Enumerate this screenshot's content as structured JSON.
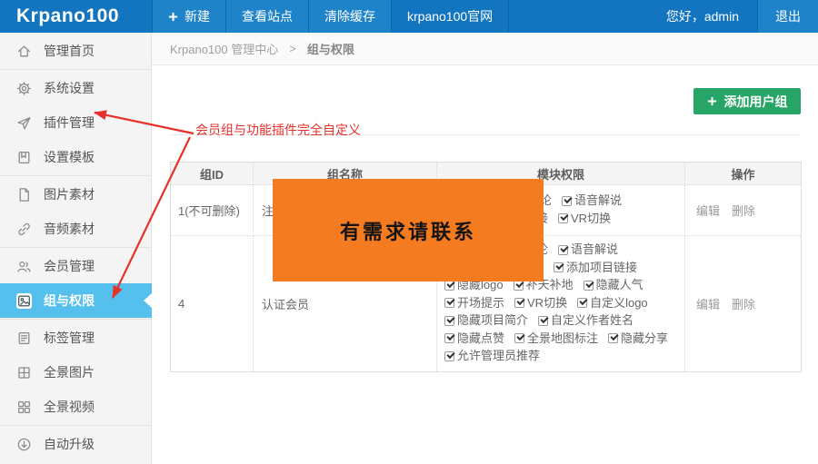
{
  "topbar": {
    "logo": "Krpano100",
    "nav": [
      {
        "name": "new",
        "label": "新建",
        "icon": "plus-icon",
        "bg": true
      },
      {
        "name": "view-site",
        "label": "查看站点",
        "bg": true
      },
      {
        "name": "clear-cache",
        "label": "清除缓存",
        "bg": true
      },
      {
        "name": "official-site",
        "label": "krpano100官网",
        "bg": false
      }
    ],
    "greeting": "您好，admin",
    "logout_label": "退出"
  },
  "sidebar": {
    "groups": [
      {
        "items": [
          {
            "name": "home",
            "icon": "home-icon",
            "label": "管理首页"
          }
        ]
      },
      {
        "items": [
          {
            "name": "system-settings",
            "icon": "gear-icon",
            "label": "系统设置"
          },
          {
            "name": "plugin-management",
            "icon": "send-icon",
            "label": "插件管理"
          },
          {
            "name": "template-settings",
            "icon": "template-icon",
            "label": "设置模板"
          }
        ]
      },
      {
        "items": [
          {
            "name": "image-assets",
            "icon": "file-icon",
            "label": "图片素材"
          },
          {
            "name": "audio-assets",
            "icon": "link-icon",
            "label": "音频素材"
          }
        ]
      },
      {
        "items": [
          {
            "name": "member-management",
            "icon": "users-icon",
            "label": "会员管理"
          },
          {
            "name": "groups-permissions",
            "icon": "image-icon",
            "label": "组与权限",
            "active": true
          }
        ]
      },
      {
        "items": [
          {
            "name": "tag-management",
            "icon": "list-icon",
            "label": "标签管理"
          },
          {
            "name": "pano-images",
            "icon": "grid-icon",
            "label": "全景图片"
          },
          {
            "name": "pano-videos",
            "icon": "squares-icon",
            "label": "全景视频"
          }
        ]
      },
      {
        "items": [
          {
            "name": "auto-upgrade",
            "icon": "download-icon",
            "label": "自动升级"
          }
        ]
      }
    ]
  },
  "breadcrumb": {
    "root": "Krpano100 管理中心",
    "separator": ">",
    "current": "组与权限"
  },
  "toolbar": {
    "add_group_label": "添加用户组"
  },
  "annotation": {
    "text": "会员组与功能插件完全自定义"
  },
  "overlay": {
    "text": "有需求请联系"
  },
  "table": {
    "headers": [
      "组ID",
      "组名称",
      "模块权限",
      "操作"
    ],
    "rows": [
      {
        "id": "1(不可删除)",
        "name": "注册会员",
        "perm_lines": [
          [
            "隐藏评论",
            "语音解说"
          ],
          [
            "添加项目链接",
            "VR切换"
          ]
        ],
        "actions": [
          "编辑",
          "删除"
        ]
      },
      {
        "id": "4",
        "name": "认证会员",
        "perm_lines": [
          [
            "隐藏评论",
            "语音解说"
          ],
          [
            "添加项目链接"
          ],
          [
            "隐藏logo",
            "补天补地",
            "隐藏人气"
          ],
          [
            "开场提示",
            "VR切换",
            "自定义logo"
          ],
          [
            "隐藏项目简介",
            "自定义作者姓名"
          ],
          [
            "隐藏点赞",
            "全景地图标注",
            "隐藏分享"
          ],
          [
            "允许管理员推荐"
          ]
        ],
        "actions": [
          "编辑",
          "删除"
        ]
      }
    ]
  },
  "colors": {
    "topbar": "#1375c0",
    "topbtn": "#1e83c9",
    "topsep": "#0d68ab",
    "active": "#55c0ee",
    "green": "#27a567",
    "orange": "#f57b20",
    "red": "#e8302a"
  }
}
